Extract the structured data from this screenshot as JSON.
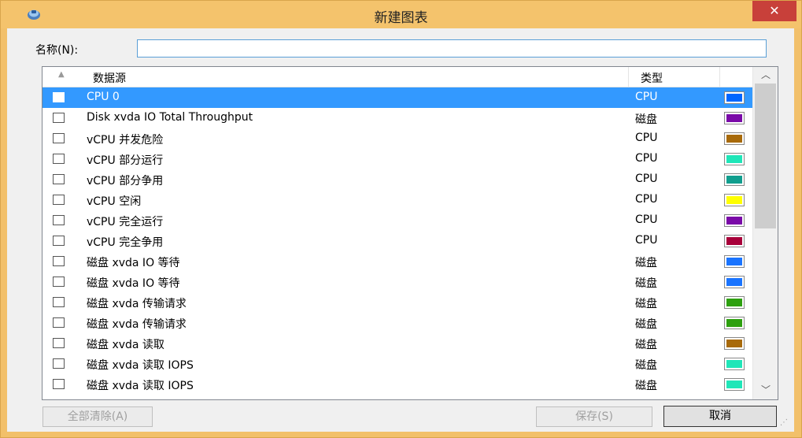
{
  "window": {
    "title": "新建图表",
    "close_glyph": "✕"
  },
  "form": {
    "name_label": "名称(N):",
    "name_value": ""
  },
  "list": {
    "sort_glyph": "▲",
    "columns": {
      "source": "数据源",
      "type": "类型"
    },
    "rows": [
      {
        "source": "CPU 0",
        "type": "CPU",
        "color": "#0066ff",
        "checked": false,
        "selected": true
      },
      {
        "source": "Disk xvda IO Total Throughput",
        "type": "磁盘",
        "color": "#7a0aa8",
        "checked": false,
        "selected": false
      },
      {
        "source": "vCPU 并发危险",
        "type": "CPU",
        "color": "#a86a0a",
        "checked": false,
        "selected": false
      },
      {
        "source": "vCPU 部分运行",
        "type": "CPU",
        "color": "#1fe6b8",
        "checked": false,
        "selected": false
      },
      {
        "source": "vCPU 部分争用",
        "type": "CPU",
        "color": "#109e8e",
        "checked": false,
        "selected": false
      },
      {
        "source": "vCPU 空闲",
        "type": "CPU",
        "color": "#ffff00",
        "checked": false,
        "selected": false
      },
      {
        "source": "vCPU 完全运行",
        "type": "CPU",
        "color": "#7a0aa8",
        "checked": false,
        "selected": false
      },
      {
        "source": "vCPU 完全争用",
        "type": "CPU",
        "color": "#a8003a",
        "checked": false,
        "selected": false
      },
      {
        "source": "磁盘 xvda IO 等待",
        "type": "磁盘",
        "color": "#1a74ff",
        "checked": false,
        "selected": false
      },
      {
        "source": "磁盘 xvda IO 等待",
        "type": "磁盘",
        "color": "#1a74ff",
        "checked": false,
        "selected": false
      },
      {
        "source": "磁盘 xvda 传输请求",
        "type": "磁盘",
        "color": "#2ea010",
        "checked": false,
        "selected": false
      },
      {
        "source": "磁盘 xvda 传输请求",
        "type": "磁盘",
        "color": "#2ea010",
        "checked": false,
        "selected": false
      },
      {
        "source": "磁盘 xvda 读取",
        "type": "磁盘",
        "color": "#a86a0a",
        "checked": false,
        "selected": false
      },
      {
        "source": "磁盘 xvda 读取 IOPS",
        "type": "磁盘",
        "color": "#1fe6b8",
        "checked": false,
        "selected": false
      },
      {
        "source": "磁盘 xvda 读取 IOPS",
        "type": "磁盘",
        "color": "#1fe6b8",
        "checked": false,
        "selected": false
      }
    ],
    "scroll_up_glyph": "︿",
    "scroll_down_glyph": "﹀"
  },
  "buttons": {
    "clear_all": "全部清除(A)",
    "save": "保存(S)",
    "cancel": "取消"
  },
  "colors": {
    "title_bar": "#f4c36c",
    "selection": "#3399ff",
    "close_button": "#c8403a"
  }
}
